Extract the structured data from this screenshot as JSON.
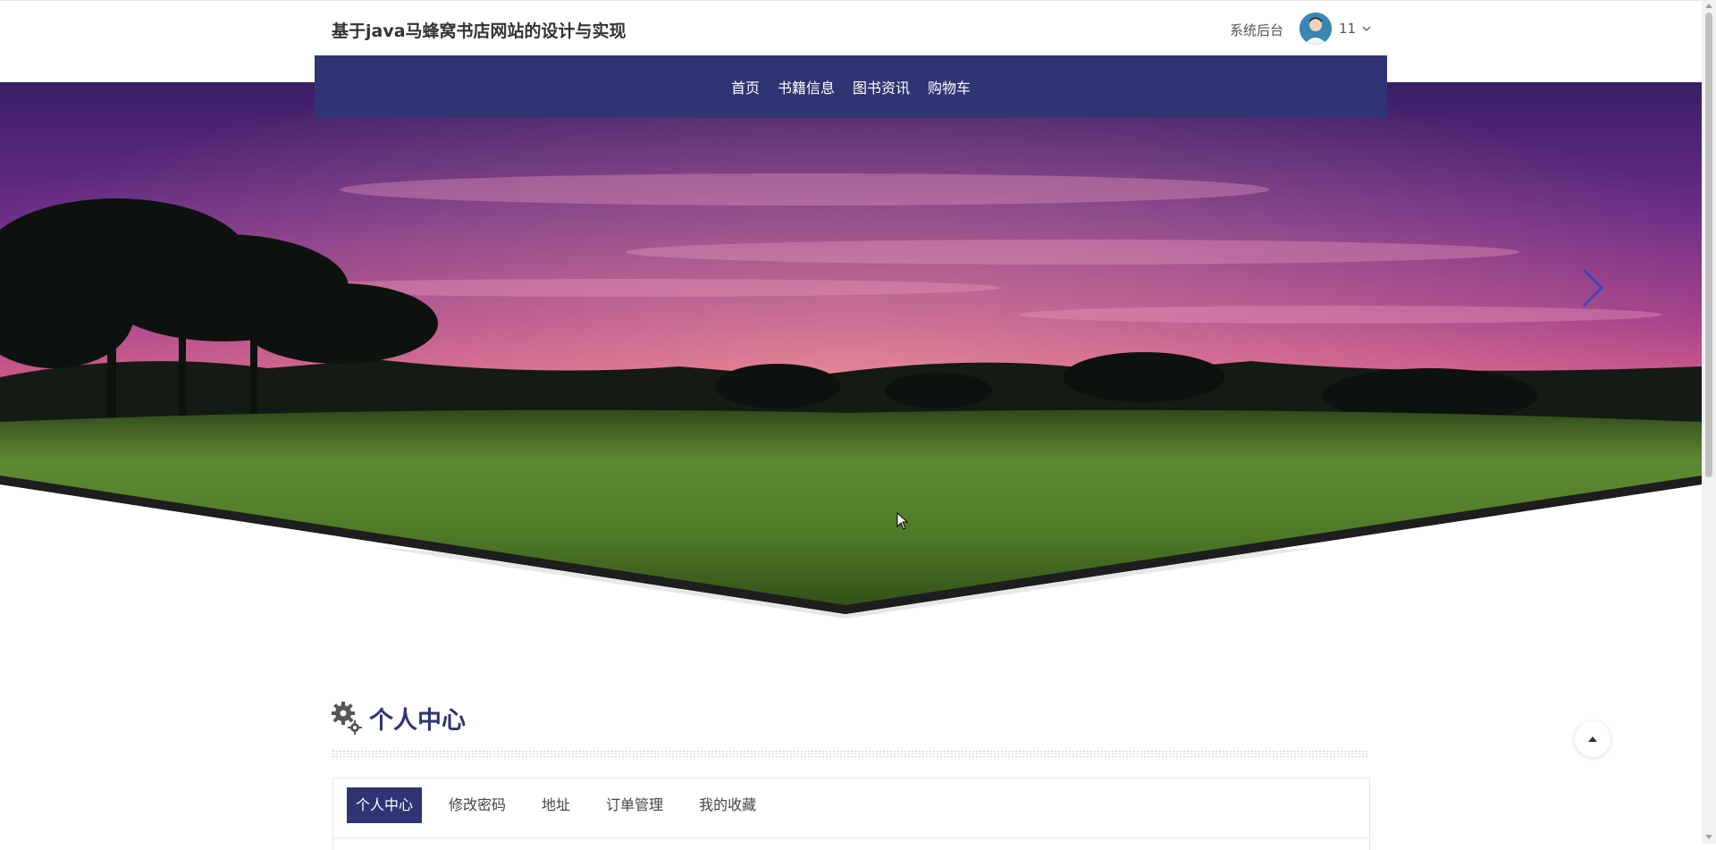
{
  "header": {
    "site_title": "基于java马蜂窝书店网站的设计与实现",
    "backend_link": "系统后台",
    "user": {
      "name": "11"
    }
  },
  "nav": {
    "items": [
      {
        "label": "首页"
      },
      {
        "label": "书籍信息"
      },
      {
        "label": "图书资讯"
      },
      {
        "label": "购物车"
      }
    ],
    "bg_color": "#2f3573"
  },
  "banner": {
    "icons": {
      "next": "chevron-right-icon"
    }
  },
  "profile": {
    "section_title": "个人中心",
    "tabs": [
      {
        "label": "个人中心",
        "active": true
      },
      {
        "label": "修改密码"
      },
      {
        "label": "地址"
      },
      {
        "label": "订单管理"
      },
      {
        "label": "我的收藏"
      }
    ]
  },
  "colors": {
    "accent": "#2f3573"
  }
}
